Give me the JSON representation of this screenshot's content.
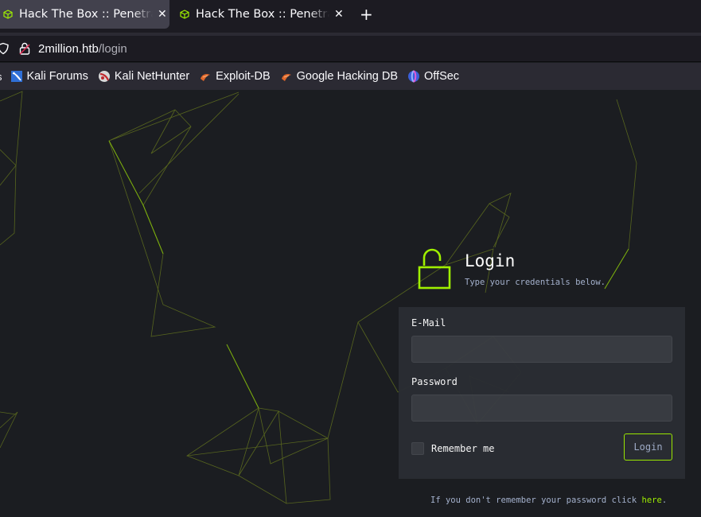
{
  "browser": {
    "tabs": [
      {
        "title": "Hack The Box :: Penetration Testing Labs",
        "active": true,
        "favicon": "htb-cube-icon"
      },
      {
        "title": "Hack The Box :: Penetration Testing Labs",
        "active": false,
        "favicon": "htb-cube-icon"
      }
    ],
    "new_tab_label": "+",
    "close_glyph": "✕",
    "url": {
      "host": "2million.htb",
      "path": "/login"
    },
    "bookmarks": [
      {
        "label": "Kali Forums",
        "icon": "kali-forums-icon"
      },
      {
        "label": "Kali NetHunter",
        "icon": "kali-nethunter-icon"
      },
      {
        "label": "Exploit-DB",
        "icon": "exploit-db-icon"
      },
      {
        "label": "Google Hacking DB",
        "icon": "ghdb-icon"
      },
      {
        "label": "OffSec",
        "icon": "offsec-icon"
      }
    ]
  },
  "login": {
    "title": "Login",
    "subtitle": "Type your credentials below.",
    "email_label": "E-Mail",
    "email_value": "",
    "password_label": "Password",
    "password_value": "",
    "remember_label": "Remember me",
    "remember_checked": false,
    "submit_label": "Login",
    "forgot_text": "If you don't remember your password click ",
    "forgot_link": "here",
    "forgot_end": "."
  },
  "colors": {
    "accent": "#9fef00",
    "background": "#1b1d21",
    "panel": "#2a2d33",
    "muted_text": "#a4b1cd"
  }
}
